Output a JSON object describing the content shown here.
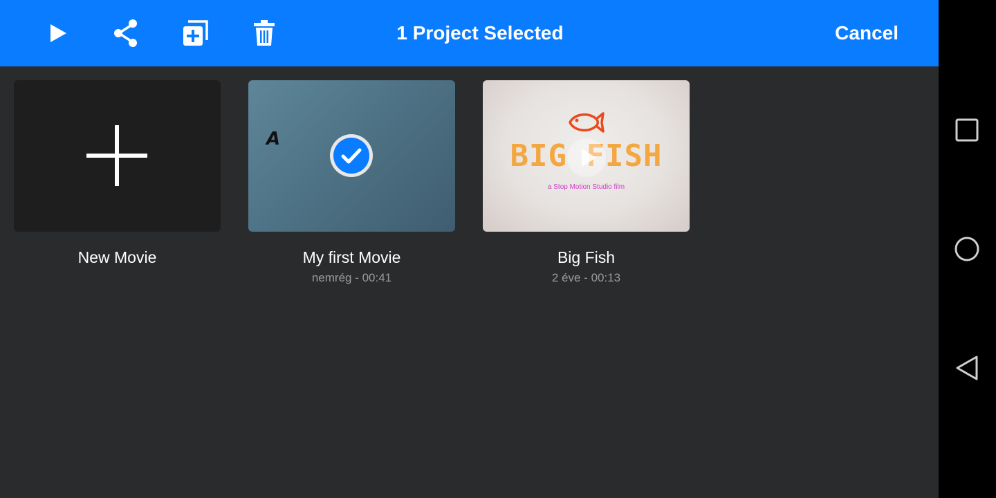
{
  "toolbar": {
    "title": "1 Project Selected",
    "cancel_label": "Cancel",
    "icons": [
      "play-icon",
      "share-icon",
      "duplicate-icon",
      "trash-icon"
    ],
    "background": "#0a7cff"
  },
  "projects": [
    {
      "title": "New Movie",
      "subtitle": "",
      "kind": "new"
    },
    {
      "title": "My first Movie",
      "subtitle": "nemrég - 00:41",
      "selected": true,
      "thumb_text": "A"
    },
    {
      "title": "Big Fish",
      "subtitle": "2 éve - 00:13",
      "selected": false,
      "thumb_title": "BIG FISH",
      "thumb_subtitle": "a Stop Motion Studio film"
    }
  ],
  "navbar": {
    "icons": [
      "recents-square-icon",
      "home-circle-icon",
      "back-triangle-icon"
    ]
  },
  "colors": {
    "accent": "#0a7cff",
    "background": "#2a2b2d",
    "subtitle": "#9a9a9a"
  }
}
